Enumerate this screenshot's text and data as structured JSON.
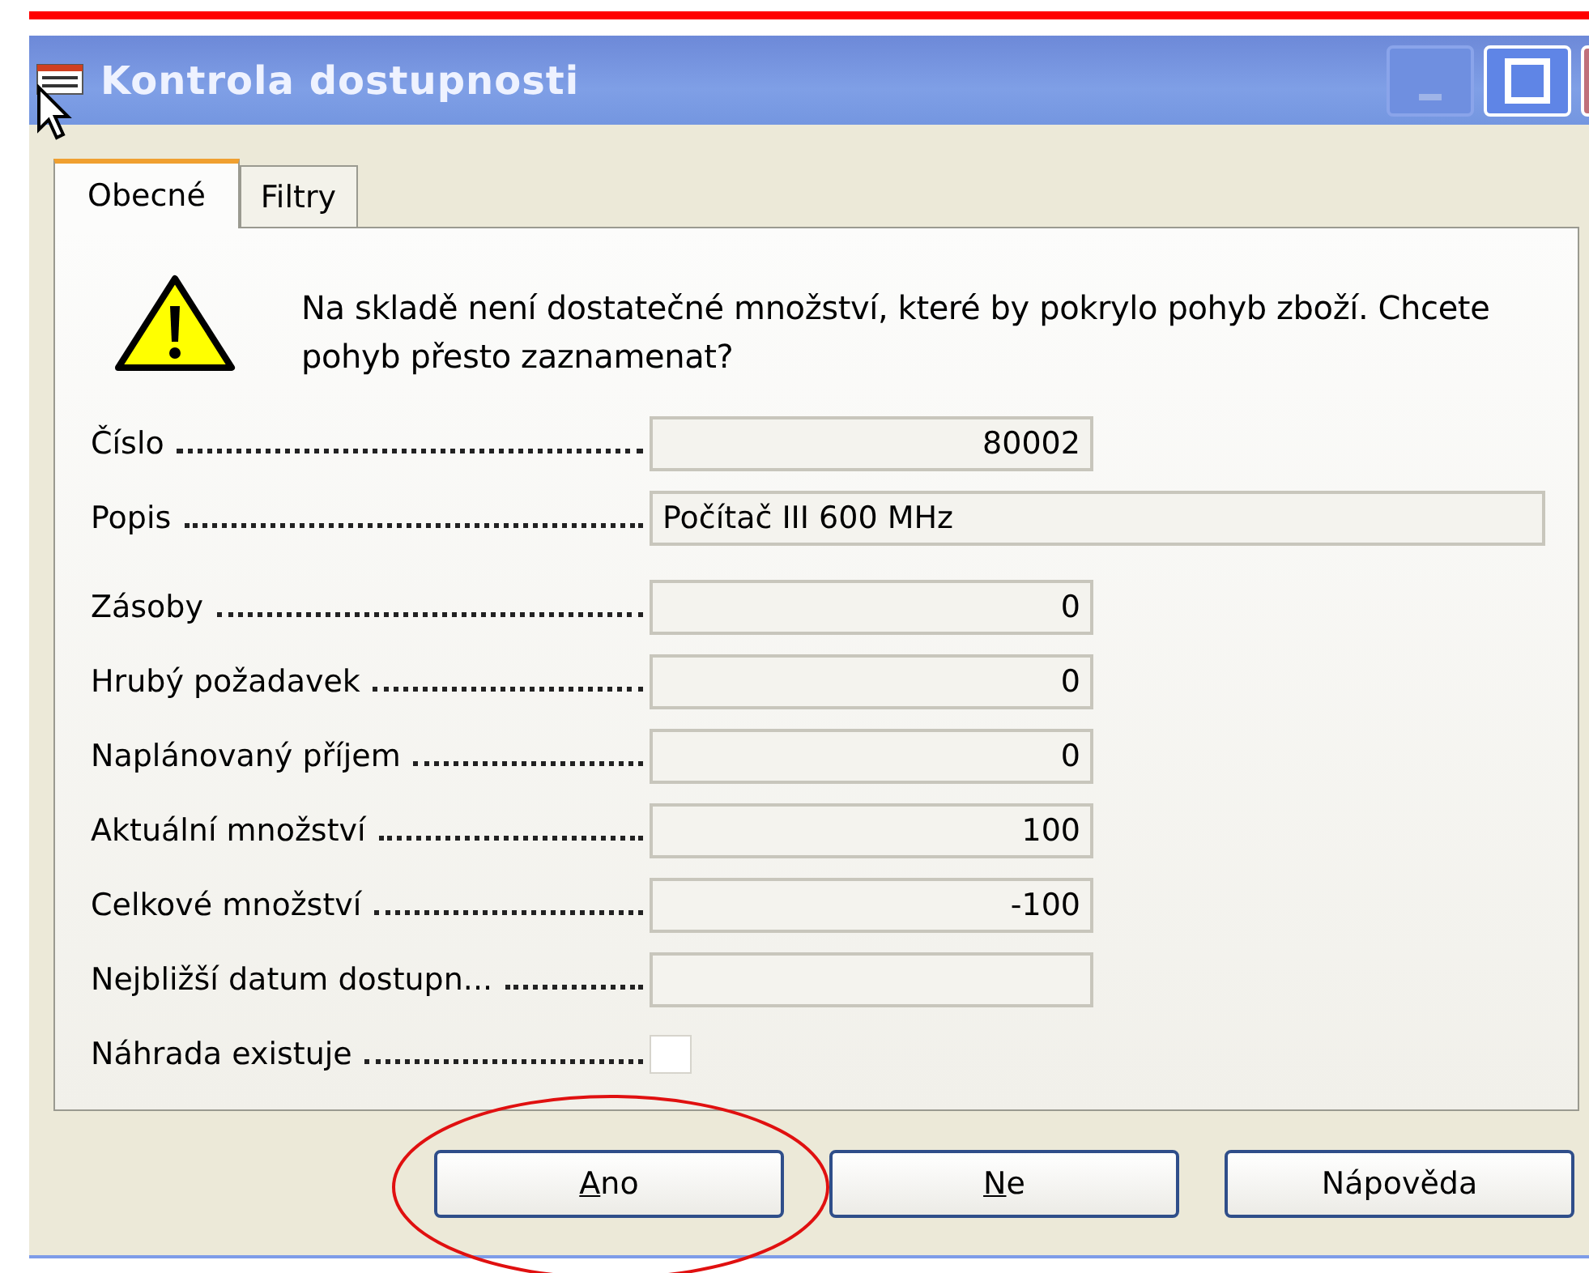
{
  "window": {
    "title": "Kontrola dostupnosti"
  },
  "tabs": [
    {
      "label": "Obecné",
      "selected": true
    },
    {
      "label": "Filtry",
      "selected": false
    }
  ],
  "message": "Na skladě není dostatečné množství, které by pokrylo pohyb zboží. Chcete pohyb přesto zaznamenat?",
  "fields": [
    {
      "label": "Číslo",
      "kind": "number",
      "value": "80002"
    },
    {
      "label": "Popis",
      "kind": "text",
      "value": "Počítač III 600 MHz"
    },
    {
      "label": "Zásoby",
      "kind": "number",
      "value": "0"
    },
    {
      "label": "Hrubý požadavek",
      "kind": "number",
      "value": "0"
    },
    {
      "label": "Naplánovaný příjem",
      "kind": "number",
      "value": "0"
    },
    {
      "label": "Aktuální množství",
      "kind": "number",
      "value": "100"
    },
    {
      "label": "Celkové množství",
      "kind": "number",
      "value": "-100"
    },
    {
      "label": "Nejbližší datum dostupn...",
      "kind": "number"
    },
    {
      "label": "Náhrada existuje",
      "kind": "checkbox",
      "checked": false
    }
  ],
  "buttons": [
    {
      "label": "Ano",
      "underline_first": true,
      "circled": true
    },
    {
      "label": "Ne",
      "underline_first": true,
      "circled": false
    },
    {
      "label": "Nápověda",
      "underline_first": false,
      "circled": false
    }
  ]
}
